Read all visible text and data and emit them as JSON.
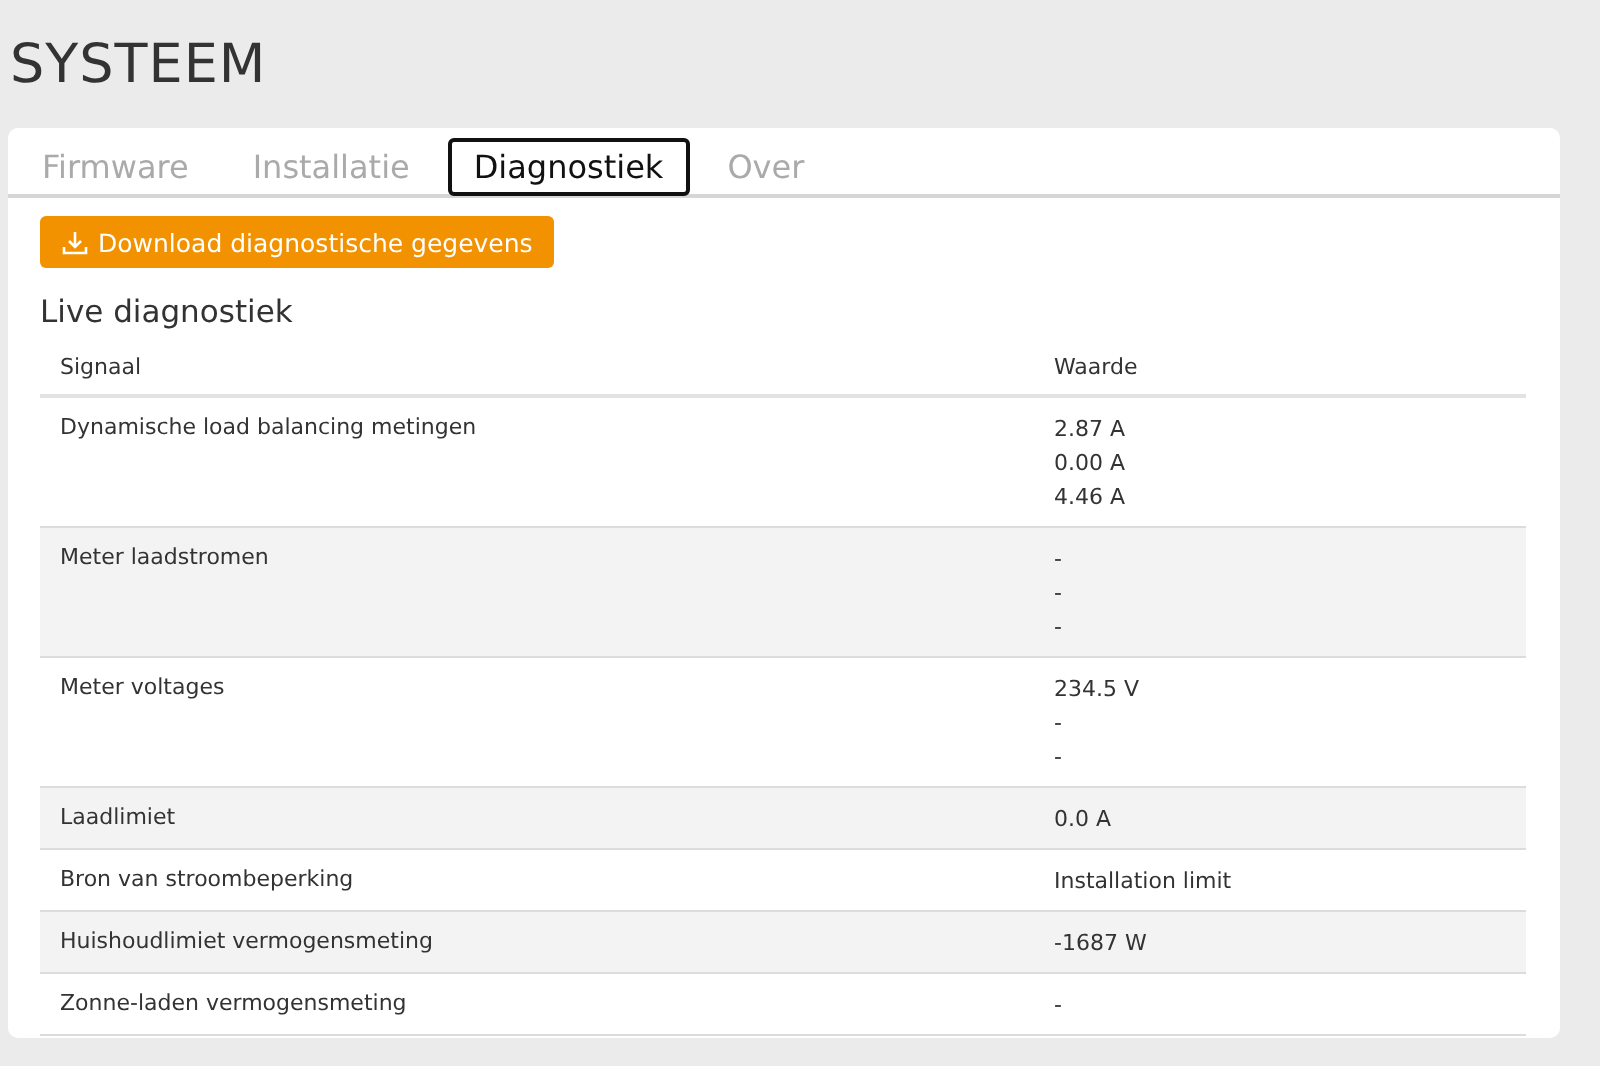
{
  "page_title": "SYSTEEM",
  "tabs": [
    {
      "label": "Firmware",
      "selected": false
    },
    {
      "label": "Installatie",
      "selected": false
    },
    {
      "label": "Diagnostiek",
      "selected": true
    },
    {
      "label": "Over",
      "selected": false
    }
  ],
  "download_button": {
    "label": "Download diagnostische gegevens"
  },
  "section_title": "Live diagnostiek",
  "table": {
    "columns": [
      "Signaal",
      "Waarde"
    ],
    "rows": [
      {
        "signal": "Dynamische load balancing metingen",
        "values": [
          "2.87 A",
          "0.00 A",
          "4.46 A"
        ]
      },
      {
        "signal": "Meter laadstromen",
        "values": [
          "-",
          "-",
          "-"
        ]
      },
      {
        "signal": "Meter voltages",
        "values": [
          "234.5 V",
          "-",
          "-"
        ]
      },
      {
        "signal": "Laadlimiet",
        "values": [
          "0.0 A"
        ]
      },
      {
        "signal": "Bron van stroombeperking",
        "values": [
          "Installation limit"
        ]
      },
      {
        "signal": "Huishoudlimiet vermogensmeting",
        "values": [
          "-1687 W"
        ]
      },
      {
        "signal": "Zonne-laden vermogensmeting",
        "values": [
          "-"
        ]
      }
    ]
  }
}
